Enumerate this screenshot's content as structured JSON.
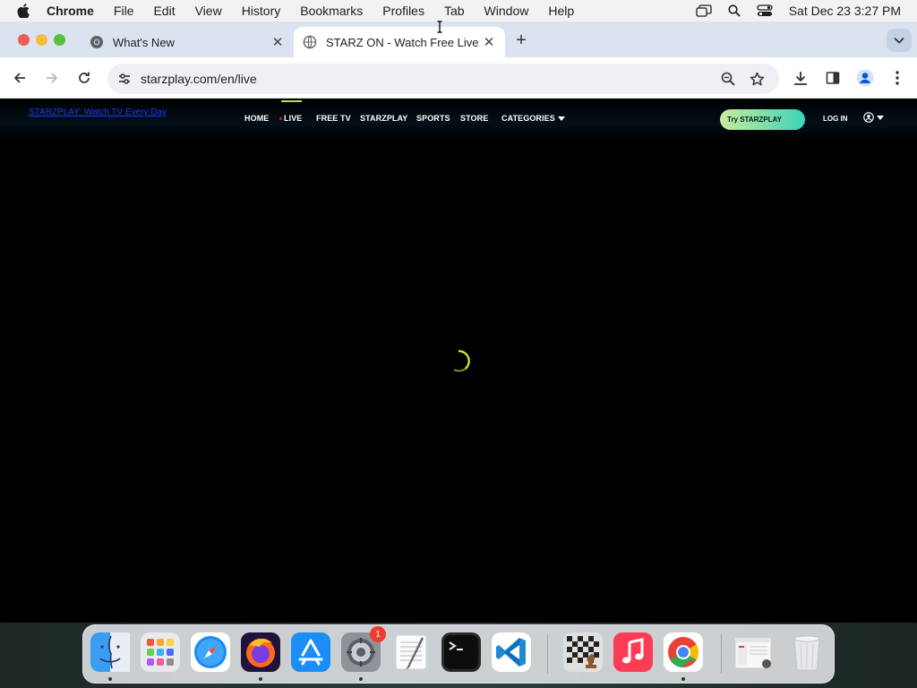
{
  "menubar": {
    "app_name": "Chrome",
    "items": [
      "File",
      "Edit",
      "View",
      "History",
      "Bookmarks",
      "Profiles",
      "Tab",
      "Window",
      "Help"
    ],
    "clock": "Sat Dec 23  3:27 PM"
  },
  "tabs": [
    {
      "title": "What's New",
      "icon": "chrome-icon",
      "active": false
    },
    {
      "title": "STARZ ON - Watch Free Live",
      "icon": "globe-icon",
      "active": true
    }
  ],
  "toolbar": {
    "url": "starzplay.com/en/live"
  },
  "site": {
    "logo_alt": "STARZPLAY: Watch TV Every Day",
    "nav": [
      {
        "label": "HOME"
      },
      {
        "label": "LIVE"
      },
      {
        "label": "FREE TV"
      },
      {
        "label": "STARZPLAY"
      },
      {
        "label": "SPORTS"
      },
      {
        "label": "STORE"
      },
      {
        "label": "CATEGORIES"
      }
    ],
    "try_button": "Try STARZPLAY",
    "login": "LOG IN",
    "accent_color": "#b6e34a"
  },
  "dock": {
    "apps": [
      "Finder",
      "Launchpad",
      "Safari",
      "Firefox",
      "App Store",
      "System Settings",
      "TextEdit",
      "Terminal",
      "Visual Studio Code",
      "Chess",
      "Music",
      "Google Chrome",
      "Preview",
      "Trash"
    ],
    "settings_badge": "1"
  }
}
